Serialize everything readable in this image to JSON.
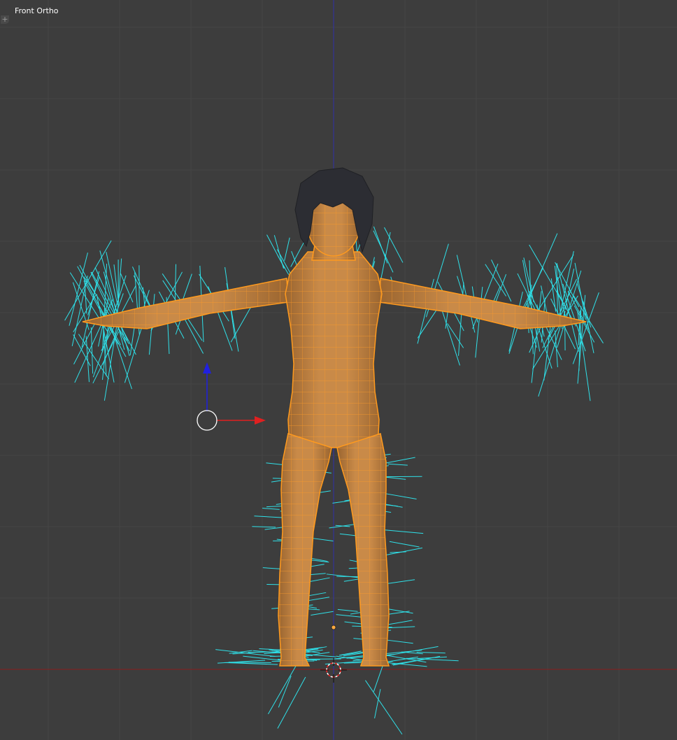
{
  "viewport": {
    "view_label": "Front Ortho",
    "region_toggle_glyph": "+"
  },
  "scene": {
    "background_color": "#3d3d3d",
    "grid_color": "#454545",
    "x_axis_color": "#8b1d1d",
    "z_axis_color": "#2e2ea8",
    "mesh_fill_color": "#c68645",
    "mesh_wire_color": "#ff9a1e",
    "normals_color": "#2fe0e8",
    "hair_color": "#2c2d33",
    "gizmo_x_color": "#e02020",
    "gizmo_z_color": "#2020e0",
    "icons": [
      "transform-manipulator-icon",
      "3d-cursor-icon",
      "object-origin-icon"
    ]
  }
}
